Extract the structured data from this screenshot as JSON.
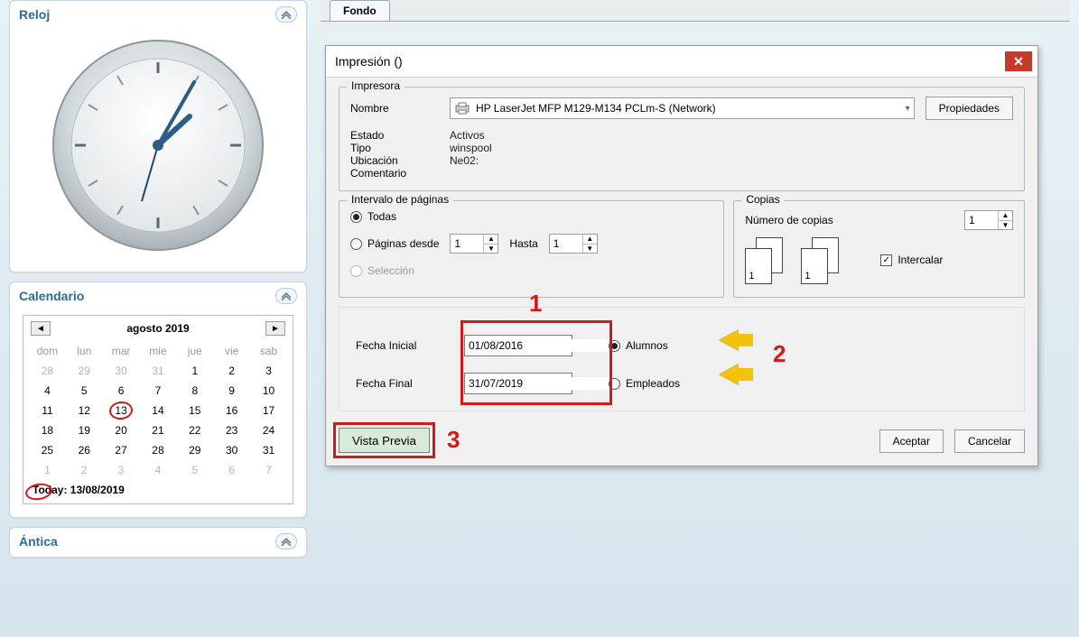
{
  "sidebar": {
    "reloj_title": "Reloj",
    "calendario_title": "Calendario",
    "antica_title": "Ántica",
    "calendar": {
      "month_label": "agosto 2019",
      "dow": [
        "dom",
        "lun",
        "mar",
        "mie",
        "jue",
        "vie",
        "sab"
      ],
      "weeks": [
        [
          {
            "d": "28",
            "dim": true
          },
          {
            "d": "29",
            "dim": true
          },
          {
            "d": "30",
            "dim": true
          },
          {
            "d": "31",
            "dim": true
          },
          {
            "d": "1"
          },
          {
            "d": "2"
          },
          {
            "d": "3"
          }
        ],
        [
          {
            "d": "4"
          },
          {
            "d": "5"
          },
          {
            "d": "6"
          },
          {
            "d": "7"
          },
          {
            "d": "8"
          },
          {
            "d": "9"
          },
          {
            "d": "10"
          }
        ],
        [
          {
            "d": "11"
          },
          {
            "d": "12"
          },
          {
            "d": "13",
            "today": true
          },
          {
            "d": "14"
          },
          {
            "d": "15"
          },
          {
            "d": "16"
          },
          {
            "d": "17"
          }
        ],
        [
          {
            "d": "18"
          },
          {
            "d": "19"
          },
          {
            "d": "20"
          },
          {
            "d": "21"
          },
          {
            "d": "22"
          },
          {
            "d": "23"
          },
          {
            "d": "24"
          }
        ],
        [
          {
            "d": "25"
          },
          {
            "d": "26"
          },
          {
            "d": "27"
          },
          {
            "d": "28"
          },
          {
            "d": "29"
          },
          {
            "d": "30"
          },
          {
            "d": "31"
          }
        ],
        [
          {
            "d": "1",
            "dim": true
          },
          {
            "d": "2",
            "dim": true
          },
          {
            "d": "3",
            "dim": true
          },
          {
            "d": "4",
            "dim": true
          },
          {
            "d": "5",
            "dim": true
          },
          {
            "d": "6",
            "dim": true
          },
          {
            "d": "7",
            "dim": true
          }
        ]
      ],
      "today_footer": "Today: 13/08/2019"
    }
  },
  "tab": {
    "fondo": "Fondo"
  },
  "dialog": {
    "title": "Impresión ()",
    "printer": {
      "group": "Impresora",
      "name_lbl": "Nombre",
      "name_val": "HP LaserJet MFP M129-M134 PCLm-S (Network)",
      "properties_btn": "Propiedades",
      "state_lbl": "Estado",
      "state_val": "Activos",
      "type_lbl": "Tipo",
      "type_val": "winspool",
      "loc_lbl": "Ubicación",
      "loc_val": "Ne02:",
      "comment_lbl": "Comentario",
      "comment_val": ""
    },
    "pages": {
      "group": "Intervalo de páginas",
      "all": "Todas",
      "from": "Páginas desde",
      "to": "Hasta",
      "from_val": "1",
      "to_val": "1",
      "selection": "Selección"
    },
    "copies": {
      "group": "Copias",
      "number_lbl": "Número de copias",
      "number_val": "1",
      "collate": "Intercalar"
    },
    "dates": {
      "start_lbl": "Fecha Inicial",
      "start_val": "01/08/2016",
      "end_lbl": "Fecha Final",
      "end_val": "31/07/2019",
      "alumnos": "Alumnos",
      "empleados": "Empleados"
    },
    "actions": {
      "preview": "Vista Previa",
      "ok": "Aceptar",
      "cancel": "Cancelar"
    }
  },
  "annotations": {
    "n1": "1",
    "n2": "2",
    "n3": "3"
  }
}
